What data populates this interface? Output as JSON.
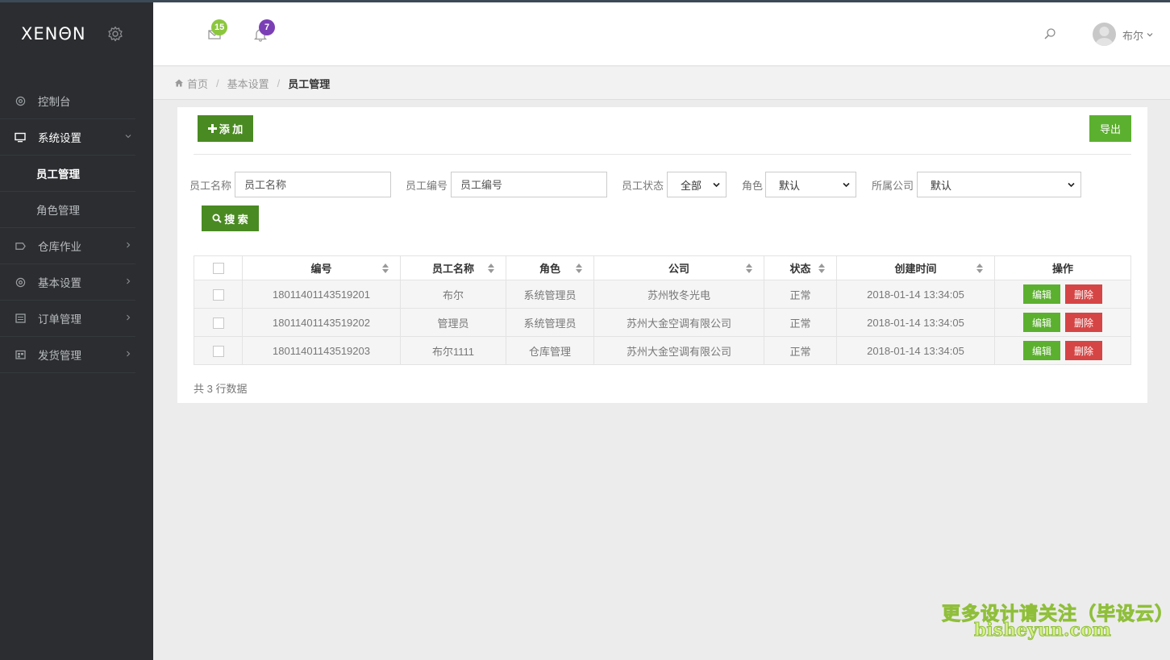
{
  "colors": {
    "sidebar_bg": "#2b2d30",
    "primary_green": "#4a8a22",
    "light_green": "#5cb02f",
    "danger_red": "#d64545",
    "mail_badge": "#8cc63f",
    "bell_badge": "#7b3fb5"
  },
  "sidebar": {
    "logo": "XENΘN",
    "logo_icon": "gear-icon",
    "items": [
      {
        "label": "控制台",
        "icon": "dashboard-icon"
      },
      {
        "label": "系统设置",
        "icon": "monitor-icon",
        "expanded": true,
        "children": [
          {
            "label": "员工管理",
            "current": true
          },
          {
            "label": "角色管理"
          }
        ]
      },
      {
        "label": "仓库作业",
        "icon": "tag-icon"
      },
      {
        "label": "基本设置",
        "icon": "settings-icon"
      },
      {
        "label": "订单管理",
        "icon": "list-icon"
      },
      {
        "label": "发货管理",
        "icon": "calendar-icon"
      }
    ]
  },
  "header": {
    "mail_count": "15",
    "bell_count": "7",
    "user_name": "布尔"
  },
  "breadcrumb": {
    "home": "首页",
    "section": "基本设置",
    "current": "员工管理"
  },
  "toolbar": {
    "add_label": "添 加",
    "export_label": "导出"
  },
  "filters": {
    "name_label": "员工名称",
    "name_placeholder": "员工名称",
    "code_label": "员工编号",
    "code_placeholder": "员工编号",
    "status_label": "员工状态",
    "status_value": "全部",
    "role_label": "角色",
    "role_value": "默认",
    "company_label": "所属公司",
    "company_value": "默认",
    "search_label": "搜 索"
  },
  "table": {
    "columns": [
      "编号",
      "员工名称",
      "角色",
      "公司",
      "状态",
      "创建时间",
      "操作"
    ],
    "edit_label": "编辑",
    "delete_label": "删除",
    "rows": [
      {
        "code": "18011401143519201",
        "name": "布尔",
        "role": "系统管理员",
        "company": "苏州牧冬光电",
        "status": "正常",
        "created": "2018-01-14 13:34:05"
      },
      {
        "code": "18011401143519202",
        "name": "管理员",
        "role": "系统管理员",
        "company": "苏州大金空调有限公司",
        "status": "正常",
        "created": "2018-01-14 13:34:05"
      },
      {
        "code": "18011401143519203",
        "name": "布尔1111",
        "role": "仓库管理",
        "company": "苏州大金空调有限公司",
        "status": "正常",
        "created": "2018-01-14 13:34:05"
      }
    ],
    "summary": "共 3 行数据"
  },
  "watermark": {
    "line1": "更多设计请关注（毕设云）",
    "line2": "bisheyun.com"
  }
}
